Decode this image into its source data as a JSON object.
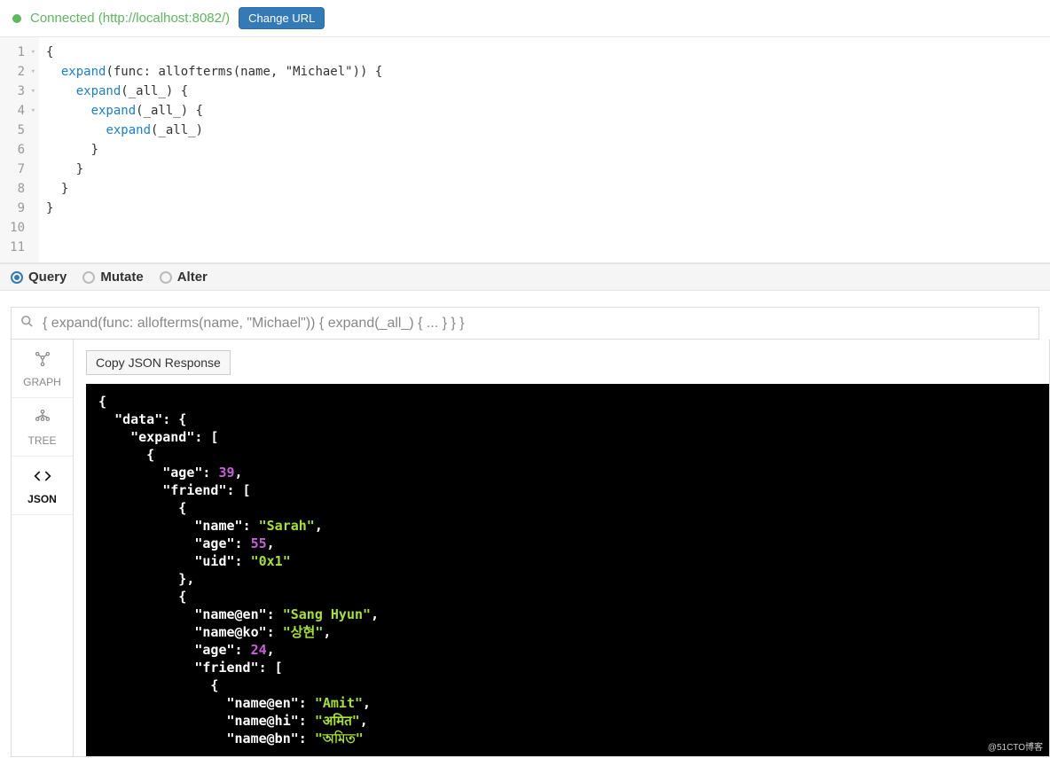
{
  "connection": {
    "status_label": "Connected",
    "url": "http://localhost:8082/",
    "change_url_label": "Change URL"
  },
  "editor": {
    "line_count": 11,
    "lines": [
      {
        "n": 1,
        "fold": true,
        "indent": 0,
        "tokens": [
          {
            "t": "{"
          }
        ]
      },
      {
        "n": 2,
        "fold": true,
        "indent": 1,
        "tokens": [
          {
            "t": "expand",
            "c": "kw"
          },
          {
            "t": "(func: allofterms(name, \"Michael\")) {"
          }
        ]
      },
      {
        "n": 3,
        "fold": true,
        "indent": 2,
        "tokens": [
          {
            "t": "expand",
            "c": "kw"
          },
          {
            "t": "(_all_) {"
          }
        ]
      },
      {
        "n": 4,
        "fold": true,
        "indent": 3,
        "tokens": [
          {
            "t": "expand",
            "c": "kw"
          },
          {
            "t": "(_all_) {"
          }
        ]
      },
      {
        "n": 5,
        "fold": false,
        "indent": 4,
        "tokens": [
          {
            "t": "expand",
            "c": "kw"
          },
          {
            "t": "(_all_)"
          }
        ]
      },
      {
        "n": 6,
        "fold": false,
        "indent": 3,
        "tokens": [
          {
            "t": "}"
          }
        ]
      },
      {
        "n": 7,
        "fold": false,
        "indent": 2,
        "tokens": [
          {
            "t": "}"
          }
        ]
      },
      {
        "n": 8,
        "fold": false,
        "indent": 1,
        "tokens": [
          {
            "t": "}"
          }
        ]
      },
      {
        "n": 9,
        "fold": false,
        "indent": 0,
        "tokens": [
          {
            "t": "}"
          }
        ]
      },
      {
        "n": 10,
        "fold": false,
        "indent": 0,
        "tokens": []
      },
      {
        "n": 11,
        "fold": false,
        "indent": 0,
        "tokens": []
      }
    ]
  },
  "actions": {
    "options": [
      {
        "id": "query",
        "label": "Query",
        "selected": true
      },
      {
        "id": "mutate",
        "label": "Mutate",
        "selected": false
      },
      {
        "id": "alter",
        "label": "Alter",
        "selected": false
      }
    ]
  },
  "query_summary": "{ expand(func: allofterms(name, \"Michael\")) { expand(_all_) { ... } } }",
  "result_tabs": [
    {
      "id": "graph",
      "label": "GRAPH",
      "icon": "graph",
      "active": false
    },
    {
      "id": "tree",
      "label": "TREE",
      "icon": "tree",
      "active": false
    },
    {
      "id": "json",
      "label": "JSON",
      "icon": "code",
      "active": true
    }
  ],
  "copy_button_label": "Copy JSON Response",
  "json_response_lines": [
    [
      {
        "t": "{"
      }
    ],
    [
      {
        "t": "  "
      },
      {
        "t": "\"data\"",
        "c": "jkey"
      },
      {
        "t": ": {"
      }
    ],
    [
      {
        "t": "    "
      },
      {
        "t": "\"expand\"",
        "c": "jkey"
      },
      {
        "t": ": ["
      }
    ],
    [
      {
        "t": "      {"
      }
    ],
    [
      {
        "t": "        "
      },
      {
        "t": "\"age\"",
        "c": "jkey"
      },
      {
        "t": ": "
      },
      {
        "t": "39",
        "c": "jnum"
      },
      {
        "t": ","
      }
    ],
    [
      {
        "t": "        "
      },
      {
        "t": "\"friend\"",
        "c": "jkey"
      },
      {
        "t": ": ["
      }
    ],
    [
      {
        "t": "          {"
      }
    ],
    [
      {
        "t": "            "
      },
      {
        "t": "\"name\"",
        "c": "jkey"
      },
      {
        "t": ": "
      },
      {
        "t": "\"Sarah\"",
        "c": "jstr"
      },
      {
        "t": ","
      }
    ],
    [
      {
        "t": "            "
      },
      {
        "t": "\"age\"",
        "c": "jkey"
      },
      {
        "t": ": "
      },
      {
        "t": "55",
        "c": "jnum"
      },
      {
        "t": ","
      }
    ],
    [
      {
        "t": "            "
      },
      {
        "t": "\"uid\"",
        "c": "jkey"
      },
      {
        "t": ": "
      },
      {
        "t": "\"0x1\"",
        "c": "jstr"
      }
    ],
    [
      {
        "t": "          },"
      }
    ],
    [
      {
        "t": "          {"
      }
    ],
    [
      {
        "t": "            "
      },
      {
        "t": "\"name@en\"",
        "c": "jkey"
      },
      {
        "t": ": "
      },
      {
        "t": "\"Sang Hyun\"",
        "c": "jstr"
      },
      {
        "t": ","
      }
    ],
    [
      {
        "t": "            "
      },
      {
        "t": "\"name@ko\"",
        "c": "jkey"
      },
      {
        "t": ": "
      },
      {
        "t": "\"상현\"",
        "c": "jstr"
      },
      {
        "t": ","
      }
    ],
    [
      {
        "t": "            "
      },
      {
        "t": "\"age\"",
        "c": "jkey"
      },
      {
        "t": ": "
      },
      {
        "t": "24",
        "c": "jnum"
      },
      {
        "t": ","
      }
    ],
    [
      {
        "t": "            "
      },
      {
        "t": "\"friend\"",
        "c": "jkey"
      },
      {
        "t": ": ["
      }
    ],
    [
      {
        "t": "              {"
      }
    ],
    [
      {
        "t": "                "
      },
      {
        "t": "\"name@en\"",
        "c": "jkey"
      },
      {
        "t": ": "
      },
      {
        "t": "\"Amit\"",
        "c": "jstr"
      },
      {
        "t": ","
      }
    ],
    [
      {
        "t": "                "
      },
      {
        "t": "\"name@hi\"",
        "c": "jkey"
      },
      {
        "t": ": "
      },
      {
        "t": "\"अमित\"",
        "c": "jstr"
      },
      {
        "t": ","
      }
    ],
    [
      {
        "t": "                "
      },
      {
        "t": "\"name@bn\"",
        "c": "jkey"
      },
      {
        "t": ": "
      },
      {
        "t": "\"অমিত\"",
        "c": "jstr"
      }
    ]
  ],
  "watermark": "@51CTO博客"
}
